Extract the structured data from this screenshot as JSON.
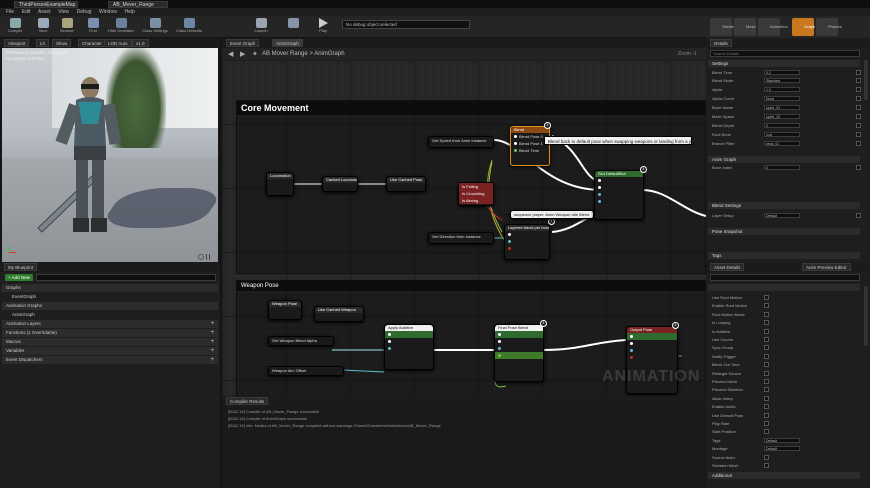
{
  "titlebar": {
    "tabs": [
      "ThirdPersonExampleMap",
      "AB_Mover_Range"
    ]
  },
  "menu": [
    "File",
    "Edit",
    "Asset",
    "View",
    "Debug",
    "Window",
    "Help"
  ],
  "toolbar": {
    "buttons": [
      "Compile",
      "Save",
      "Browse",
      "Find",
      "Hide Unrelated",
      "Class Settings",
      "Class Defaults",
      "Play",
      "Launch"
    ],
    "debug_filter": "No debug object selected"
  },
  "mode_buttons": [
    "Skeleton",
    "Mesh",
    "Animation",
    "Graph",
    "Physics"
  ],
  "viewport": {
    "tabs": [
      "Viewport",
      "Lit",
      "Show",
      "Character",
      "LOD Auto",
      "x1.0"
    ],
    "info_lines": [
      "Previewing AnimBP_Character",
      "No assets selected"
    ]
  },
  "my_blueprint": {
    "tab": "My Blueprint",
    "add_label": "+ Add New",
    "rows": [
      {
        "label": "Graphs",
        "header": true,
        "plus": false
      },
      {
        "label": "EventGraph",
        "header": false,
        "plus": false
      },
      {
        "label": "Animation Graphs",
        "header": true,
        "plus": false
      },
      {
        "label": "AnimGraph",
        "header": false,
        "plus": false
      },
      {
        "label": "Animation Layers",
        "header": true,
        "plus": true
      },
      {
        "label": "Functions (1 Overridable)",
        "header": true,
        "plus": true
      },
      {
        "label": "Macros",
        "header": true,
        "plus": true
      },
      {
        "label": "Variables",
        "header": true,
        "plus": true
      },
      {
        "label": "Event Dispatchers",
        "header": true,
        "plus": true
      }
    ]
  },
  "graph": {
    "tabs": [
      "Event Graph",
      "AnimGraph"
    ],
    "breadcrumb": "AB Mover Range > AnimGraph",
    "zoom": "Zoom -1",
    "comments": [
      "Core Movement",
      "Weapon Pose"
    ],
    "tooltip": "Blend back to default pose when swapping weapons or landing from a jump",
    "watermark": "ANIMATION",
    "nodes": {
      "state_machine": "Locomotion",
      "cache": "Cached Locomotion",
      "use_cache": "Use Cached Pose",
      "slot": "Slot DefaultSlot",
      "blend": "Blend",
      "layered": "Layered blend per bone",
      "output": "Output Pose",
      "get_speed": "Get Speed from Anim Instance",
      "get_dir": "Get Direction from Instance",
      "bools": [
        "Is Falling",
        "Is Crouching",
        "Is Aiming"
      ],
      "blend_pins": [
        "Blend Pose 0",
        "Blend Pose 1",
        "Blend Time"
      ],
      "weapon_nodes": [
        "Weapon Pose",
        "Use Cached Weapon",
        "Get Weapon Blend Alpha",
        "Weapon Aim Offset",
        "Apply Additive",
        "Final Pose Blend"
      ],
      "param_label": "sequence player: Anim Weapon Idle Blend"
    }
  },
  "log": {
    "tab": "Compiler Results",
    "lines": [
      "[0042.18] Compile of AB_Mover_Range successful!",
      "[0042.18] Compile of AnimGraph successful!",
      "[0042.19] Info: Nodes of AB_Mover_Range compiled without warnings /Game/Characters/Animations/AB_Mover_Range"
    ]
  },
  "details": {
    "tab": "Details",
    "search_placeholder": "Search Details",
    "sections": [
      "Settings",
      "Anim Graph",
      "Blend Settings",
      "Pose Snapshot",
      "Tags"
    ],
    "rows": [
      {
        "label": "Blend Time",
        "value": "0.2"
      },
      {
        "label": "Blend Mode",
        "value": "Standard"
      },
      {
        "label": "Alpha",
        "value": "1.0"
      },
      {
        "label": "Alpha Curve",
        "value": "None"
      },
      {
        "label": "Bone Name",
        "value": "spine_01"
      },
      {
        "label": "Mesh Space",
        "value": "spine_02"
      },
      {
        "label": "Blend Depth",
        "value": "0"
      },
      {
        "label": "Root Bone",
        "value": "root"
      },
      {
        "label": "Branch Filter",
        "value": "neck_01"
      },
      {
        "label": "Bone Index",
        "value": "0"
      },
      {
        "label": "Layer Setup",
        "value": "Default"
      }
    ]
  },
  "anim_panel": {
    "tabs": [
      "Asset Details",
      "Anim Preview Editor"
    ],
    "rows": [
      "Use Root Motion",
      "Enable Root Motion",
      "Root Motion Mode",
      "Is Looping",
      "Is Additive",
      "Use Curves",
      "Sync Group",
      "Notify Trigger",
      "Blend Out Time",
      "Retarget Source",
      "Preview Mesh",
      "Preview Skeleton",
      "Allow Interp",
      "Enable Audio",
      "Use Default Pose",
      "Play Rate",
      "Start Position",
      "Tags",
      "Montage",
      "Source Anim",
      "Skeleton Mesh"
    ],
    "selects": [
      "Default",
      "Default"
    ],
    "footer": "Additional"
  }
}
